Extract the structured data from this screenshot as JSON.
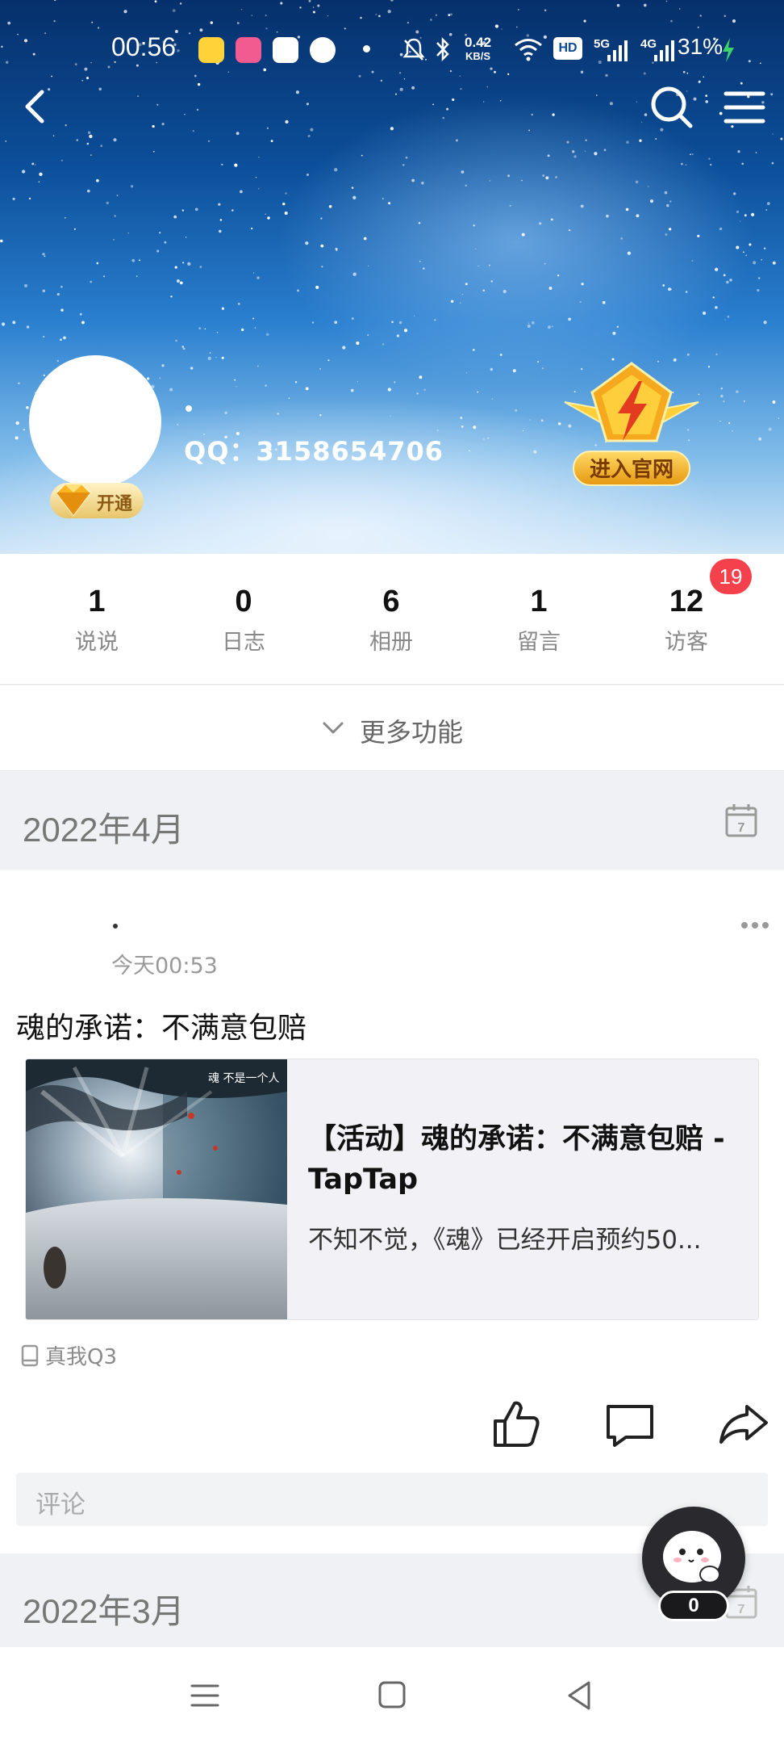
{
  "status_bar": {
    "time": "00:56",
    "net_speed_value": "0.42",
    "net_speed_unit": "KB/S",
    "hd_label": "HD",
    "net1": "5G",
    "net2": "4G",
    "battery": "31%"
  },
  "profile": {
    "nickname": ".",
    "qq_label": "QQ：3158654706",
    "vip_label": "开通",
    "official_site_label": "进入官网"
  },
  "stats": [
    {
      "value": "1",
      "label": "说说"
    },
    {
      "value": "0",
      "label": "日志"
    },
    {
      "value": "6",
      "label": "相册"
    },
    {
      "value": "1",
      "label": "留言"
    },
    {
      "value": "12",
      "label": "访客"
    }
  ],
  "visitor_badge": "19",
  "more_functions_label": "更多功能",
  "months": [
    {
      "label": "2022年4月",
      "calendar_day": "7"
    },
    {
      "label": "2022年3月",
      "calendar_day": "7"
    }
  ],
  "post": {
    "author": ".",
    "time": "今天00:53",
    "text": "魂的承诺：不满意包赔",
    "link": {
      "title": "【活动】魂的承诺：不满意包赔 - TapTap",
      "description": "不知不觉，《魂》已经开启预约50...",
      "thumb_caption": "魂 不是一个人"
    },
    "device": "真我Q3",
    "comment_placeholder": "评论"
  },
  "floating": {
    "count": "0"
  },
  "colors": {
    "accent_red": "#f5414b",
    "gold": "#e69a12",
    "bg": "#f0f1f4"
  },
  "icons": [
    "back-icon",
    "search-icon",
    "menu-icon",
    "chevron-down-icon",
    "calendar-icon",
    "more-dots-icon",
    "phone-icon",
    "like-icon",
    "comment-icon",
    "share-icon",
    "nav-menu-icon",
    "nav-home-icon",
    "nav-back-icon"
  ]
}
